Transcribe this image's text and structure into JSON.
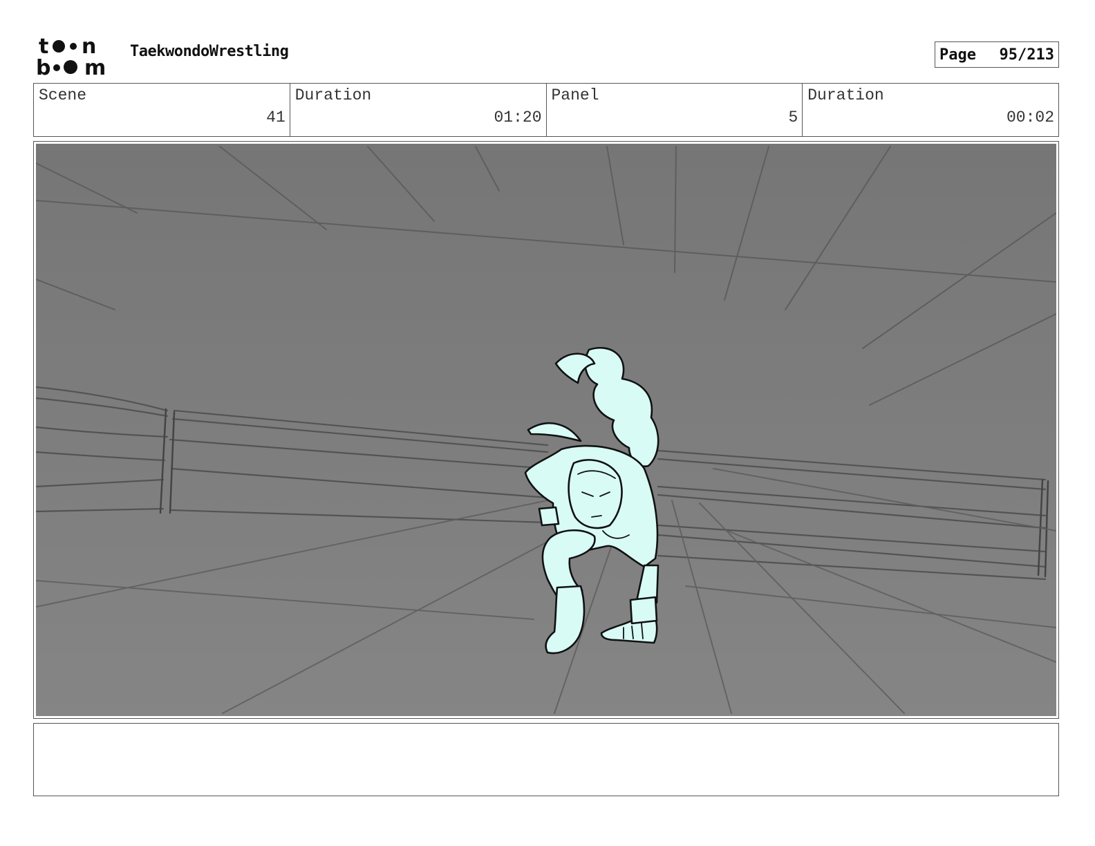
{
  "header": {
    "logo": {
      "icon": "toon-boom-logo",
      "text_top": "toon",
      "text_bottom": "boom"
    },
    "project_title": "TaekwondoWrestling",
    "page_label": "Page",
    "page_value": "95/213"
  },
  "info": {
    "scene_label": "Scene",
    "scene_value": "41",
    "scene_duration_label": "Duration",
    "scene_duration_value": "01:20",
    "panel_label": "Panel",
    "panel_value": "5",
    "panel_duration_label": "Duration",
    "panel_duration_value": "00:02"
  },
  "panel": {
    "image": "storyboard-sketch-wrestling-ring",
    "background_color": "#7f7f7f",
    "character_color": "#d8fbf6"
  },
  "notes": {
    "text": ""
  }
}
